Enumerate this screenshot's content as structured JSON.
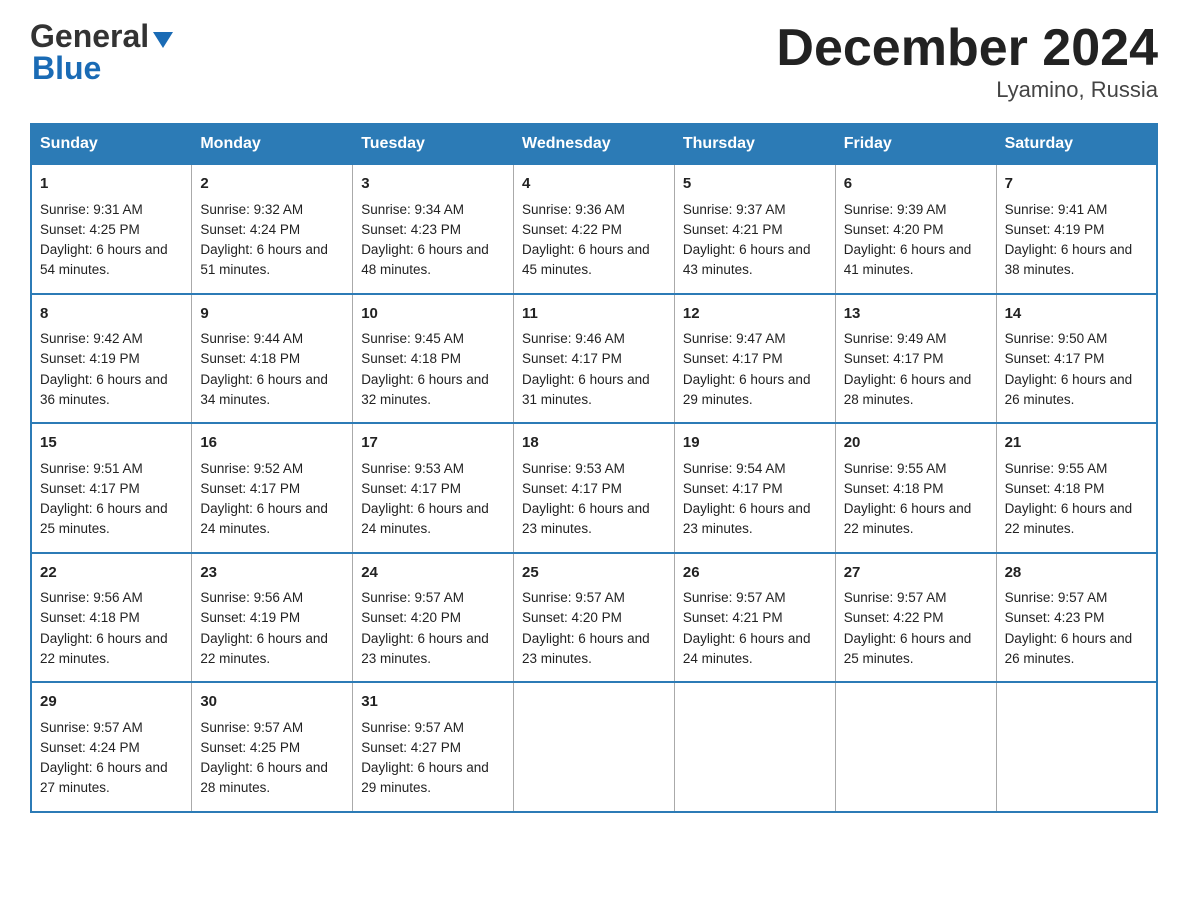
{
  "logo": {
    "general": "General",
    "blue": "Blue"
  },
  "title": "December 2024",
  "subtitle": "Lyamino, Russia",
  "days_of_week": [
    "Sunday",
    "Monday",
    "Tuesday",
    "Wednesday",
    "Thursday",
    "Friday",
    "Saturday"
  ],
  "weeks": [
    [
      {
        "day": "1",
        "sunrise": "9:31 AM",
        "sunset": "4:25 PM",
        "daylight": "6 hours and 54 minutes."
      },
      {
        "day": "2",
        "sunrise": "9:32 AM",
        "sunset": "4:24 PM",
        "daylight": "6 hours and 51 minutes."
      },
      {
        "day": "3",
        "sunrise": "9:34 AM",
        "sunset": "4:23 PM",
        "daylight": "6 hours and 48 minutes."
      },
      {
        "day": "4",
        "sunrise": "9:36 AM",
        "sunset": "4:22 PM",
        "daylight": "6 hours and 45 minutes."
      },
      {
        "day": "5",
        "sunrise": "9:37 AM",
        "sunset": "4:21 PM",
        "daylight": "6 hours and 43 minutes."
      },
      {
        "day": "6",
        "sunrise": "9:39 AM",
        "sunset": "4:20 PM",
        "daylight": "6 hours and 41 minutes."
      },
      {
        "day": "7",
        "sunrise": "9:41 AM",
        "sunset": "4:19 PM",
        "daylight": "6 hours and 38 minutes."
      }
    ],
    [
      {
        "day": "8",
        "sunrise": "9:42 AM",
        "sunset": "4:19 PM",
        "daylight": "6 hours and 36 minutes."
      },
      {
        "day": "9",
        "sunrise": "9:44 AM",
        "sunset": "4:18 PM",
        "daylight": "6 hours and 34 minutes."
      },
      {
        "day": "10",
        "sunrise": "9:45 AM",
        "sunset": "4:18 PM",
        "daylight": "6 hours and 32 minutes."
      },
      {
        "day": "11",
        "sunrise": "9:46 AM",
        "sunset": "4:17 PM",
        "daylight": "6 hours and 31 minutes."
      },
      {
        "day": "12",
        "sunrise": "9:47 AM",
        "sunset": "4:17 PM",
        "daylight": "6 hours and 29 minutes."
      },
      {
        "day": "13",
        "sunrise": "9:49 AM",
        "sunset": "4:17 PM",
        "daylight": "6 hours and 28 minutes."
      },
      {
        "day": "14",
        "sunrise": "9:50 AM",
        "sunset": "4:17 PM",
        "daylight": "6 hours and 26 minutes."
      }
    ],
    [
      {
        "day": "15",
        "sunrise": "9:51 AM",
        "sunset": "4:17 PM",
        "daylight": "6 hours and 25 minutes."
      },
      {
        "day": "16",
        "sunrise": "9:52 AM",
        "sunset": "4:17 PM",
        "daylight": "6 hours and 24 minutes."
      },
      {
        "day": "17",
        "sunrise": "9:53 AM",
        "sunset": "4:17 PM",
        "daylight": "6 hours and 24 minutes."
      },
      {
        "day": "18",
        "sunrise": "9:53 AM",
        "sunset": "4:17 PM",
        "daylight": "6 hours and 23 minutes."
      },
      {
        "day": "19",
        "sunrise": "9:54 AM",
        "sunset": "4:17 PM",
        "daylight": "6 hours and 23 minutes."
      },
      {
        "day": "20",
        "sunrise": "9:55 AM",
        "sunset": "4:18 PM",
        "daylight": "6 hours and 22 minutes."
      },
      {
        "day": "21",
        "sunrise": "9:55 AM",
        "sunset": "4:18 PM",
        "daylight": "6 hours and 22 minutes."
      }
    ],
    [
      {
        "day": "22",
        "sunrise": "9:56 AM",
        "sunset": "4:18 PM",
        "daylight": "6 hours and 22 minutes."
      },
      {
        "day": "23",
        "sunrise": "9:56 AM",
        "sunset": "4:19 PM",
        "daylight": "6 hours and 22 minutes."
      },
      {
        "day": "24",
        "sunrise": "9:57 AM",
        "sunset": "4:20 PM",
        "daylight": "6 hours and 23 minutes."
      },
      {
        "day": "25",
        "sunrise": "9:57 AM",
        "sunset": "4:20 PM",
        "daylight": "6 hours and 23 minutes."
      },
      {
        "day": "26",
        "sunrise": "9:57 AM",
        "sunset": "4:21 PM",
        "daylight": "6 hours and 24 minutes."
      },
      {
        "day": "27",
        "sunrise": "9:57 AM",
        "sunset": "4:22 PM",
        "daylight": "6 hours and 25 minutes."
      },
      {
        "day": "28",
        "sunrise": "9:57 AM",
        "sunset": "4:23 PM",
        "daylight": "6 hours and 26 minutes."
      }
    ],
    [
      {
        "day": "29",
        "sunrise": "9:57 AM",
        "sunset": "4:24 PM",
        "daylight": "6 hours and 27 minutes."
      },
      {
        "day": "30",
        "sunrise": "9:57 AM",
        "sunset": "4:25 PM",
        "daylight": "6 hours and 28 minutes."
      },
      {
        "day": "31",
        "sunrise": "9:57 AM",
        "sunset": "4:27 PM",
        "daylight": "6 hours and 29 minutes."
      },
      null,
      null,
      null,
      null
    ]
  ]
}
